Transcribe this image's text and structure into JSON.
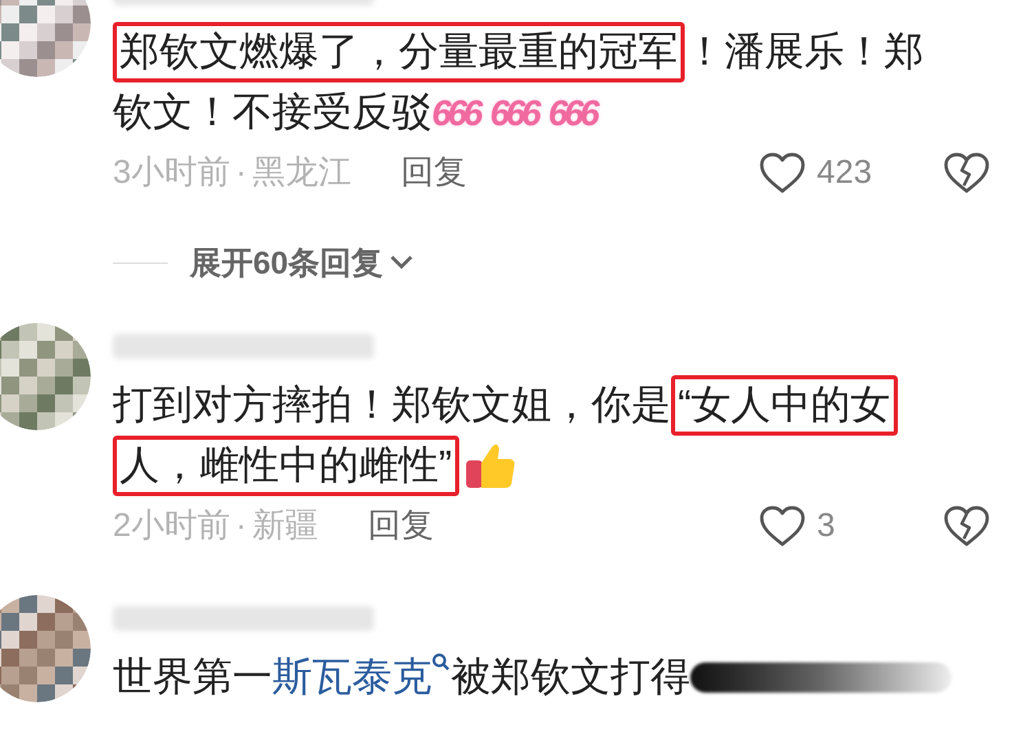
{
  "comments": [
    {
      "lines": [
        [
          {
            "kind": "highlight",
            "text": "郑钦文燃爆了，分量最重的冠军"
          },
          {
            "kind": "text",
            "text": "！潘展乐！郑"
          }
        ],
        [
          {
            "kind": "text",
            "text": "钦文！不接受反驳"
          },
          {
            "kind": "sticker",
            "text": "666"
          },
          {
            "kind": "sticker",
            "text": "666"
          },
          {
            "kind": "sticker",
            "text": "666"
          }
        ]
      ],
      "time": "3小时前",
      "separator": "·",
      "location": "黑龙江",
      "reply": "回复",
      "likes": "423",
      "expand": "展开60条回复"
    },
    {
      "lines": [
        [
          {
            "kind": "text",
            "text": "打到对方摔拍！郑钦文姐，你是"
          },
          {
            "kind": "highlight",
            "text": "“女人中的女"
          }
        ],
        [
          {
            "kind": "highlight",
            "text": "人，雌性中的雌性”"
          },
          {
            "kind": "thumb"
          }
        ]
      ],
      "time": "2小时前",
      "separator": "·",
      "location": "新疆",
      "reply": "回复",
      "likes": "3"
    },
    {
      "lines": [
        [
          {
            "kind": "text",
            "text": "世界第一"
          },
          {
            "kind": "link",
            "text": "斯瓦泰克"
          },
          {
            "kind": "text",
            "text": "被郑钦文打得"
          },
          {
            "kind": "smear"
          }
        ]
      ]
    }
  ]
}
